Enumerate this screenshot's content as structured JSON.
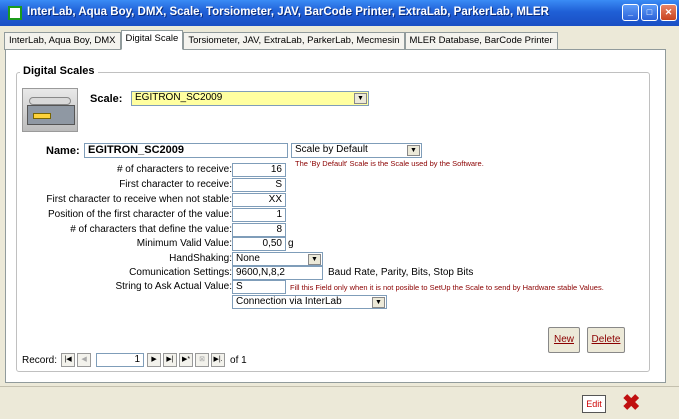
{
  "window": {
    "title": "InterLab, Aqua Boy, DMX, Scale, Torsiometer, JAV, BarCode Printer, ExtraLab, ParkerLab, MLER",
    "minimize_glyph": "_",
    "maximize_glyph": "□",
    "close_glyph": "✕"
  },
  "tabs": [
    {
      "label": "InterLab, Aqua Boy, DMX"
    },
    {
      "label": "Digital Scale"
    },
    {
      "label": "Torsiometer, JAV, ExtraLab, ParkerLab, Mecmesin"
    },
    {
      "label": "MLER Database, BarCode Printer"
    }
  ],
  "group": {
    "title": "Digital Scales"
  },
  "scale": {
    "label": "Scale:",
    "value": "EGITRON_SC2009"
  },
  "name": {
    "label": "Name:",
    "value": "EGITRON_SC2009"
  },
  "default_select": {
    "value": "Scale by Default",
    "note": "The 'By Default' Scale is the Scale used by the Software."
  },
  "settings": [
    {
      "label": "# of characters to receive:",
      "value": "16"
    },
    {
      "label": "First character to receive:",
      "value": "S"
    },
    {
      "label": "First character to receive when not stable:",
      "value": "XX"
    },
    {
      "label": "Position of the first character of the value:",
      "value": "1"
    },
    {
      "label": "# of characters that define the value:",
      "value": "8"
    },
    {
      "label": "Minimum Valid Value:",
      "value": "0,50",
      "unit": "g"
    }
  ],
  "handshaking": {
    "label": "HandShaking:",
    "value": "None"
  },
  "comm": {
    "label": "Comunication Settings:",
    "value": "9600,N,8,2",
    "hint": "Baud Rate, Parity, Bits, Stop Bits"
  },
  "ask": {
    "label": "String to Ask Actual Value:",
    "value": "S",
    "note": "Fill this Field only when it is not posible to SetUp the Scale to send by Hardware stable Values."
  },
  "connection": {
    "value": "Connection via InterLab"
  },
  "buttons": {
    "new": "New",
    "delete": "Delete"
  },
  "record": {
    "label": "Record:",
    "current": "1",
    "of": "of  1"
  },
  "nav_glyphs": {
    "first": "|◀",
    "prev": "◀",
    "next": "▶",
    "last": "▶|",
    "new": "▶*",
    "delete": "⊠",
    "filter": "▶|."
  },
  "footer": {
    "edit": "Edit",
    "close": "✖"
  }
}
